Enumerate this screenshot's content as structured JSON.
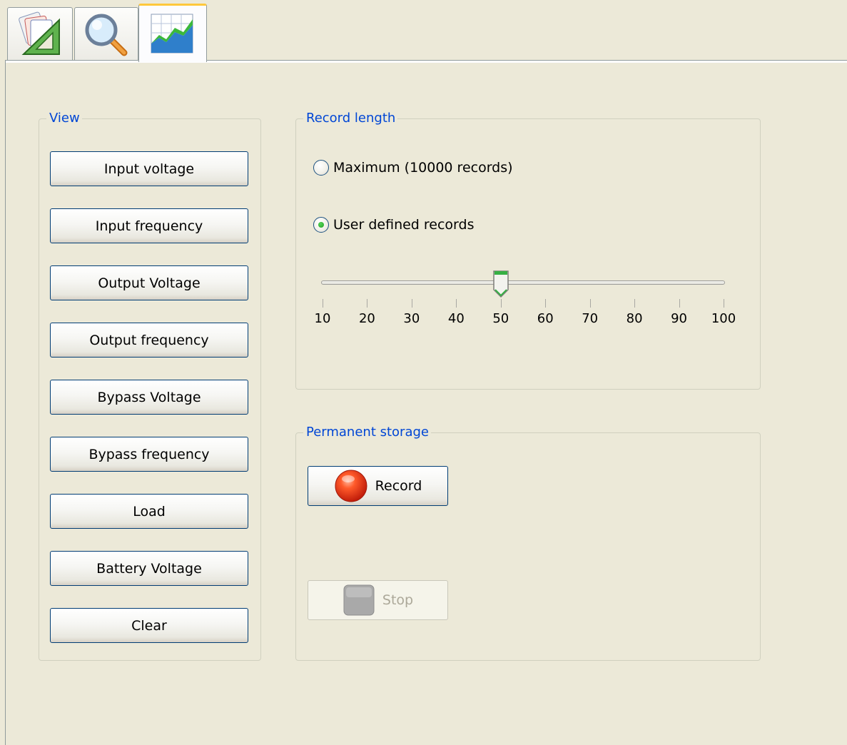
{
  "tabs": [
    {
      "icon": "setup-triangle-icon"
    },
    {
      "icon": "magnifier-icon"
    },
    {
      "icon": "chart-graph-icon",
      "active": true
    }
  ],
  "view_group": {
    "legend": "View",
    "buttons": [
      "Input voltage",
      "Input frequency",
      "Output Voltage",
      "Output frequency",
      "Bypass Voltage",
      "Bypass frequency",
      "Load",
      "Battery Voltage",
      "Clear"
    ]
  },
  "record_length": {
    "legend": "Record length",
    "option_max": "Maximum (10000 records)",
    "option_user": "User defined records",
    "selected": "user",
    "slider": {
      "min": 10,
      "max": 100,
      "value": 50,
      "tick_labels": [
        "10",
        "20",
        "30",
        "40",
        "50",
        "60",
        "70",
        "80",
        "90",
        "100"
      ]
    }
  },
  "permanent_storage": {
    "legend": "Permanent storage",
    "record_label": "Record",
    "stop_label": "Stop",
    "record_icon": "record-red-circle-icon",
    "stop_icon": "stop-square-icon",
    "stop_enabled": false
  },
  "colors": {
    "legend_text": "#0046d5",
    "window_bg": "#ece9d8",
    "button_border": "#003c74",
    "record_red": "#e83a1a",
    "active_tab_highlight": "#ffc83c"
  }
}
